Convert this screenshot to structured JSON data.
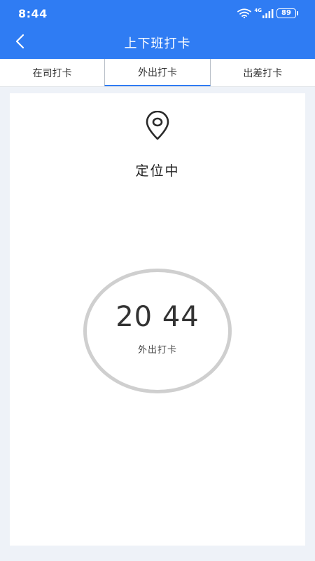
{
  "status_bar": {
    "time": "8:44",
    "battery": "89",
    "network": "4G",
    "icons": [
      "wifi-icon",
      "signal-icon",
      "battery-icon"
    ]
  },
  "header": {
    "title": "上下班打卡",
    "back_icon": "chevron-left-icon"
  },
  "tabs": [
    {
      "label": "在司打卡",
      "active": false
    },
    {
      "label": "外出打卡",
      "active": true
    },
    {
      "label": "出差打卡",
      "active": false
    }
  ],
  "main": {
    "location_icon": "location-pin-icon",
    "location_status": "定位中",
    "punch": {
      "time": "20 44",
      "label": "外出打卡"
    }
  },
  "colors": {
    "primary": "#2f7cf3",
    "page_bg": "#eef2f8",
    "circle_border": "#cfcfcf"
  }
}
